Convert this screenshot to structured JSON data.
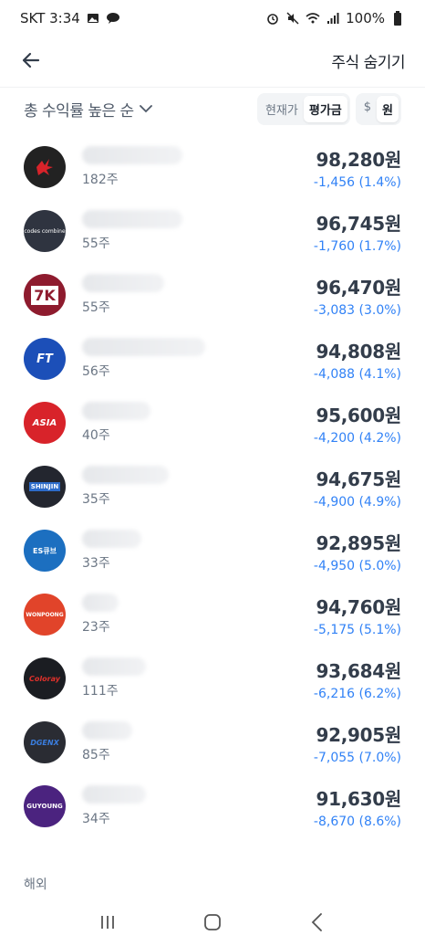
{
  "status_bar": {
    "carrier_time": "SKT 3:34",
    "battery": "100%"
  },
  "header": {
    "hide_label": "주식 숨기기"
  },
  "filter": {
    "sort_label": "총 수익률 높은 순",
    "price_toggle": [
      "현재가",
      "평가금"
    ],
    "price_toggle_selected": "평가금",
    "currency_toggle": [
      "$",
      "원"
    ],
    "currency_toggle_selected": "원"
  },
  "holdings": [
    {
      "qty": "182주",
      "value": "98,280원",
      "change": "-1,456 (1.4%)",
      "logo_text": "",
      "logo_color": "#222222",
      "logo_icon": "dragon-logo-icon"
    },
    {
      "qty": "55주",
      "value": "96,745원",
      "change": "-1,760 (1.7%)",
      "logo_text": "codes combine",
      "logo_color": "#2f3440",
      "logo_icon": "codes-combine-logo-icon"
    },
    {
      "qty": "55주",
      "value": "96,470원",
      "change": "-3,083 (3.0%)",
      "logo_text": "7K",
      "logo_color": "#8e1b2e",
      "logo_icon": "seven-k-logo-icon"
    },
    {
      "qty": "56주",
      "value": "94,808원",
      "change": "-4,088 (4.1%)",
      "logo_text": "FT",
      "logo_color": "#1c4fb8",
      "logo_icon": "ft-logo-icon"
    },
    {
      "qty": "40주",
      "value": "95,600원",
      "change": "-4,200 (4.2%)",
      "logo_text": "ASIA",
      "logo_color": "#d8232a",
      "logo_icon": "asia-logo-icon"
    },
    {
      "qty": "35주",
      "value": "94,675원",
      "change": "-4,900 (4.9%)",
      "logo_text": "SHINJIN",
      "logo_color": "#23262f",
      "logo_icon": "shinjin-logo-icon"
    },
    {
      "qty": "33주",
      "value": "92,895원",
      "change": "-4,950 (5.0%)",
      "logo_text": "ES큐브",
      "logo_color": "#1c6fc0",
      "logo_icon": "escube-logo-icon"
    },
    {
      "qty": "23주",
      "value": "94,760원",
      "change": "-5,175 (5.1%)",
      "logo_text": "WONPOONG",
      "logo_color": "#e1442a",
      "logo_icon": "wonpoong-logo-icon"
    },
    {
      "qty": "111주",
      "value": "93,684원",
      "change": "-6,216 (6.2%)",
      "logo_text": "Coloray",
      "logo_color": "#1b1d22",
      "logo_icon": "coloray-logo-icon"
    },
    {
      "qty": "85주",
      "value": "92,905원",
      "change": "-7,055 (7.0%)",
      "logo_text": "DGENX",
      "logo_color": "#2a2c33",
      "logo_icon": "dgenx-logo-icon"
    },
    {
      "qty": "34주",
      "value": "91,630원",
      "change": "-8,670 (8.6%)",
      "logo_text": "GUYOUNG",
      "logo_color": "#4b237f",
      "logo_icon": "guyoung-logo-icon"
    }
  ],
  "section": {
    "overseas_label": "해외"
  },
  "colors": {
    "loss_blue": "#3182f6",
    "text_primary": "#191f28",
    "text_secondary": "#6b7684"
  }
}
